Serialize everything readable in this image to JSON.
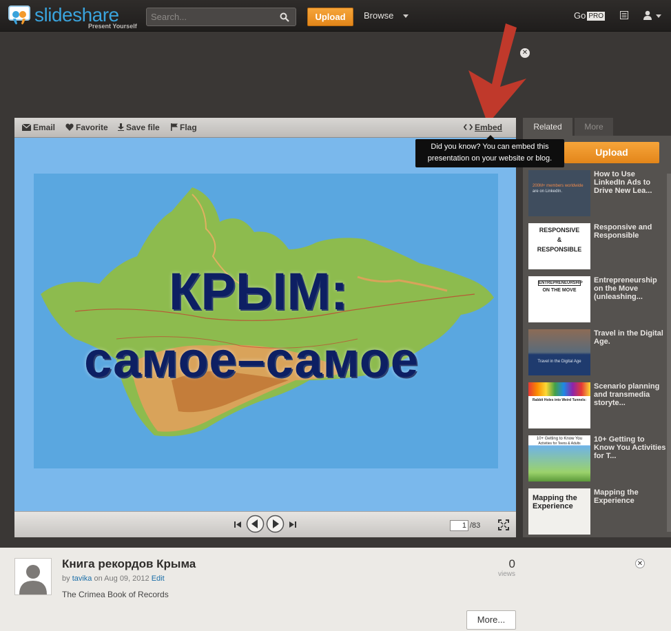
{
  "header": {
    "logo_text": "slideshare",
    "logo_tagline": "Present Yourself",
    "search_placeholder": "Search...",
    "upload_label": "Upload",
    "browse_label": "Browse",
    "go_label": "Go",
    "pro_badge": "PRO"
  },
  "player": {
    "toolbar": {
      "email": "Email",
      "favorite": "Favorite",
      "save_file": "Save file",
      "flag": "Flag",
      "embed": "Embed"
    },
    "tooltip": "Did you know? You can embed this presentation on your website or blog.",
    "slide": {
      "title_line1": "КРЫМ:",
      "title_line2": "самое–самое"
    },
    "pagination": {
      "current": "1",
      "total": "/83"
    }
  },
  "sidebar": {
    "tabs": [
      {
        "label": "Related"
      },
      {
        "label": "More"
      }
    ],
    "upload_label": "Upload",
    "items": [
      {
        "title": "How to Use LinkedIn Ads to Drive New Lea...",
        "thumb_lines": [
          "200M+ members worldwide",
          "are on LinkedIn."
        ]
      },
      {
        "title": "Responsive and Responsible",
        "thumb_lines": [
          "RESPONSIVE",
          "&",
          "RESPONSIBLE"
        ]
      },
      {
        "title": "Entrepreneurship on the Move (unleashing...",
        "thumb_lines": [
          "ENTREPRENEURSHIP",
          "ON THE MOVE"
        ]
      },
      {
        "title": "Travel in the Digital Age.",
        "thumb_lines": [
          "Travel in the Digital Age"
        ]
      },
      {
        "title": "Scenario planning and transmedia storyte...",
        "thumb_lines": [
          "Rabbit Holes into Weird Tunnels:"
        ]
      },
      {
        "title": "10+ Getting to Know You Activities for T...",
        "thumb_lines": [
          "10+ Getting to Know You",
          "Activities for Teens & Adults"
        ]
      },
      {
        "title": "Mapping the Experience",
        "thumb_lines": [
          "Mapping the",
          "Experience"
        ]
      }
    ]
  },
  "info": {
    "title": "Книга рекордов Крыма",
    "meta_by": "by",
    "author": "tavika",
    "meta_on": "on Aug 09, 2012",
    "edit_label": "Edit",
    "description": "The Crimea Book of Records",
    "views_count": "0",
    "views_label": "views",
    "more_label": "More..."
  },
  "colors": {
    "accent_orange": "#f39a2c",
    "brand_blue": "#3aa3dc",
    "arrow_red": "#c0392b",
    "slide_blue": "#7ab8ec",
    "title_navy": "#0d1f63"
  },
  "icons": [
    "search-icon",
    "email-icon",
    "heart-icon",
    "download-icon",
    "flag-icon",
    "embed-icon",
    "close-icon",
    "list-icon",
    "user-icon",
    "first-page-icon",
    "prev-icon",
    "next-icon",
    "last-page-icon",
    "fullscreen-icon"
  ]
}
